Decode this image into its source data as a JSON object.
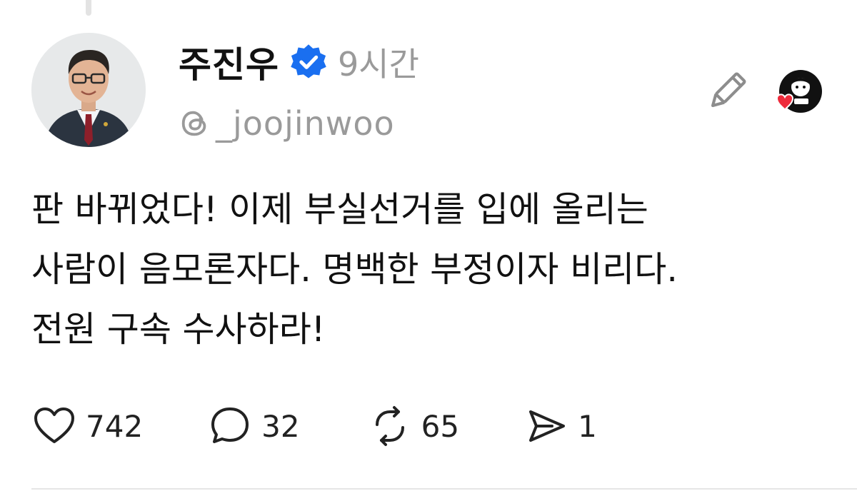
{
  "post": {
    "author_name": "주진우",
    "timestamp": "9시간",
    "handle": "_joojinwoo",
    "body_lines": [
      "판 바뀌었다! 이제 부실선거를 입에 올리는",
      "사람이 음모론자다. 명백한 부정이자 비리다.",
      "전원 구속 수사하라!"
    ],
    "verified": true
  },
  "actions": {
    "likes": "742",
    "replies": "32",
    "reposts": "65",
    "shares": "1"
  },
  "icons": {
    "verified": "verified-badge-icon",
    "threads": "threads-logo-icon",
    "edit": "pencil-icon",
    "like": "heart-icon",
    "reply": "comment-bubble-icon",
    "repost": "repost-icon",
    "share": "send-icon",
    "reactor_heart": "red-heart-icon"
  },
  "colors": {
    "verified_blue": "#1a6ff0",
    "muted_gray": "#9a9a9a",
    "heart_red": "#ee2b3b"
  }
}
